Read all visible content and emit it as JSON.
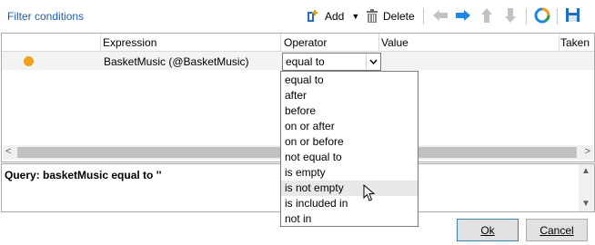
{
  "panel": {
    "title": "Filter conditions"
  },
  "toolbar": {
    "add_label": "Add",
    "delete_label": "Delete",
    "icons": [
      "add-condition-icon",
      "dropdown-arrow-icon",
      "delete-icon",
      "arrow-left-icon",
      "arrow-right-icon",
      "arrow-up-icon",
      "arrow-down-icon",
      "distribution-chart-icon",
      "save-icon"
    ]
  },
  "grid": {
    "columns": [
      "Expression",
      "Operator",
      "Value",
      "Taken"
    ],
    "rows": [
      {
        "expression": "BasketMusic (@BasketMusic)",
        "operator": "equal to",
        "value": ""
      }
    ]
  },
  "operator_options": [
    "equal to",
    "after",
    "before",
    "on or after",
    "on or before",
    "not equal to",
    "is empty",
    "is not empty",
    "is included in",
    "not in"
  ],
  "hovered_option": "is not empty",
  "query": {
    "text": "Query: basketMusic equal to ''"
  },
  "buttons": {
    "ok": "Ok",
    "cancel": "Cancel"
  },
  "colors": {
    "accent": "#1f5fa8",
    "status_dot": "#f0a21b",
    "arrow_blue": "#1e88e5"
  }
}
